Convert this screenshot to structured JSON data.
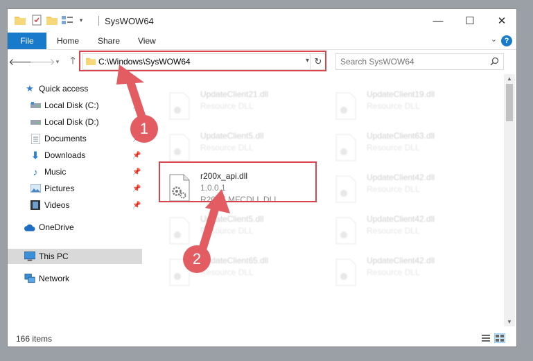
{
  "window": {
    "title": "SysWOW64",
    "controls": {
      "minimize": "—",
      "maximize": "☐",
      "close": "✕"
    }
  },
  "ribbon": {
    "file_tab": "File",
    "tabs": [
      "Home",
      "Share",
      "View"
    ],
    "help": "?"
  },
  "address": {
    "path": "C:\\Windows\\SysWOW64",
    "search_placeholder": "Search SysWOW64"
  },
  "navigation": {
    "quick_access": "Quick access",
    "items": [
      {
        "label": "Local Disk (C:)",
        "icon": "drive-icon",
        "pinned": true
      },
      {
        "label": "Local Disk (D:)",
        "icon": "drive-icon",
        "pinned": true
      },
      {
        "label": "Documents",
        "icon": "documents-icon",
        "pinned": true
      },
      {
        "label": "Downloads",
        "icon": "downloads-icon",
        "pinned": true
      },
      {
        "label": "Music",
        "icon": "music-icon",
        "pinned": true
      },
      {
        "label": "Pictures",
        "icon": "pictures-icon",
        "pinned": true
      },
      {
        "label": "Videos",
        "icon": "videos-icon",
        "pinned": true
      }
    ],
    "onedrive": "OneDrive",
    "this_pc": "This PC",
    "network": "Network"
  },
  "files": {
    "highlighted": {
      "name": "r200x_api.dll",
      "version": "1.0.0.1",
      "description": "R200X MFCDLL DLL"
    },
    "left_column": [
      {
        "name": "UpdateClient21.dll",
        "type": "Resource DLL"
      },
      {
        "name": "UpdateClient5.dll",
        "type": "Resource DLL"
      },
      {
        "name": "UpdateClient5.dll",
        "type": "Resource DLL"
      },
      {
        "name": "UpdateClient65.dll",
        "type": "Resource DLL"
      }
    ],
    "right_column": [
      {
        "name": "UpdateClient19.dll",
        "type": "Resource DLL"
      },
      {
        "name": "UpdateClient63.dll",
        "type": "Resource DLL"
      },
      {
        "name": "UpdateClient42.dll",
        "type": "Resource DLL"
      },
      {
        "name": "UpdateClient42.dll",
        "type": "Resource DLL"
      },
      {
        "name": "UpdateClient42.dll",
        "type": "Resource DLL"
      }
    ]
  },
  "status": {
    "item_count": "166 items"
  },
  "annotations": {
    "marker_1": "1",
    "marker_2": "2",
    "color": "#e25c62"
  },
  "colors": {
    "accent": "#1979ca",
    "highlight_border": "#d9434d",
    "selected_nav": "#d9d9d9"
  }
}
